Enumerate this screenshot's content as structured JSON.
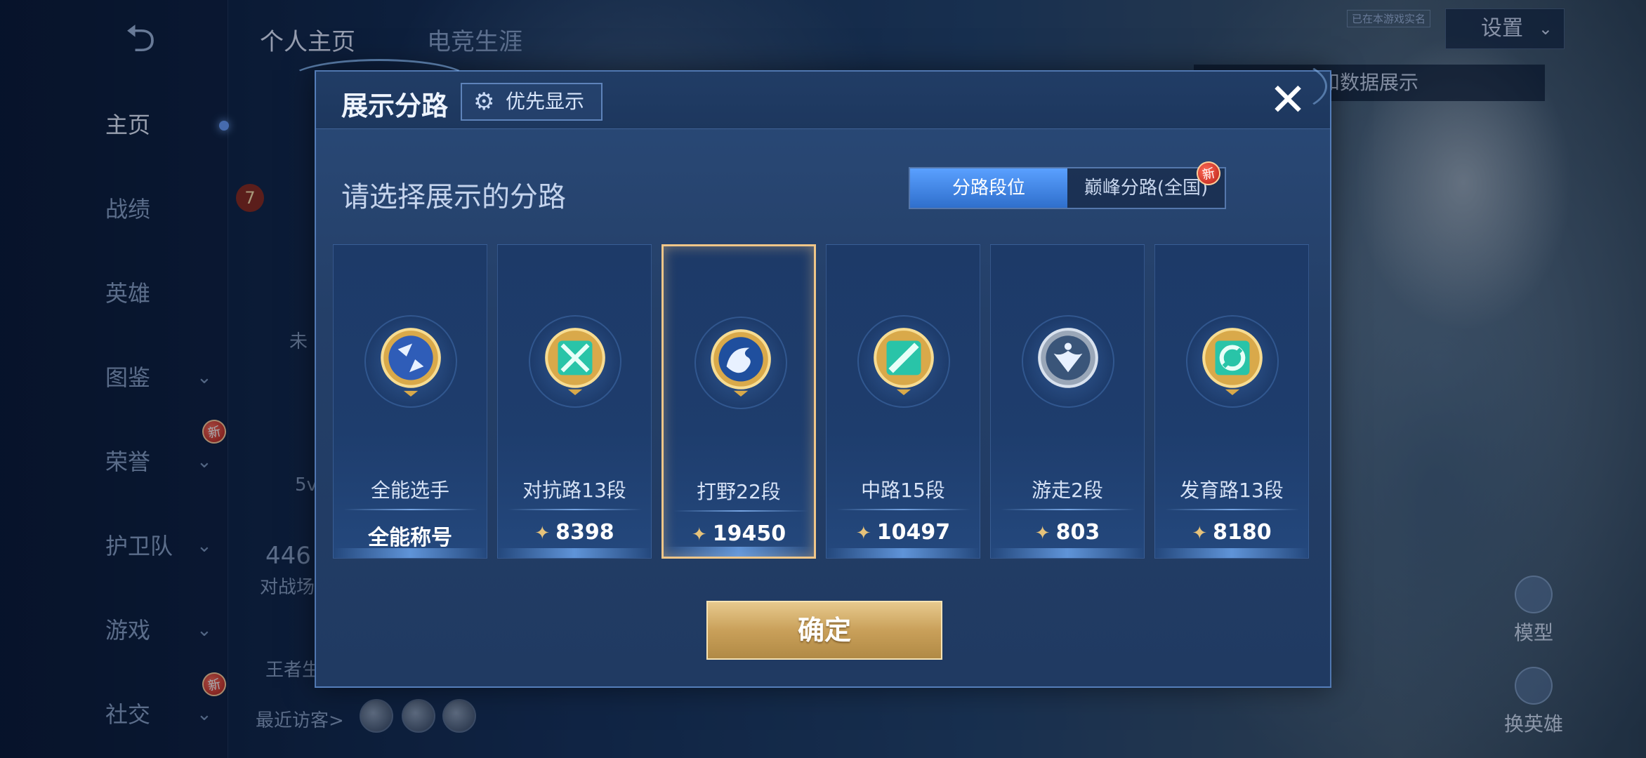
{
  "sidebar": {
    "items": [
      {
        "label": "主页"
      },
      {
        "label": "战绩"
      },
      {
        "label": "英雄"
      },
      {
        "label": "图鉴"
      },
      {
        "label": "荣誉",
        "badge": "新"
      },
      {
        "label": "护卫队"
      },
      {
        "label": "游戏"
      },
      {
        "label": "社交",
        "badge": "新"
      }
    ]
  },
  "top_tabs": [
    "个人主页",
    "电竞生涯"
  ],
  "top_right": {
    "tag": "已在本游戏实名",
    "settings_label": "设置",
    "hint": "点切换灵宝和数据展示"
  },
  "background_text": {
    "level": "7",
    "left_stat_a": "5v",
    "left_stat_num": "446",
    "left_stat_label": "对战场",
    "left_glory": "王者生",
    "recent_visitors": "最近访客>",
    "unlabeled": "未"
  },
  "right_buttons": [
    {
      "label": "模型",
      "icon": "model-icon"
    },
    {
      "label": "换英雄",
      "icon": "swap-hero-icon"
    }
  ],
  "dialog": {
    "title": "展示分路",
    "priority_label": "优先显示",
    "prompt": "请选择展示的分路",
    "tabs": [
      {
        "label": "分路段位",
        "active": true
      },
      {
        "label": "巅峰分路(全国)",
        "active": false,
        "badge": "新"
      }
    ],
    "cards": [
      {
        "name": "全能选手",
        "value": "全能称号",
        "has_points_icon": false,
        "selected": false,
        "emblem": "all-round-emblem-icon"
      },
      {
        "name": "对抗路13段",
        "value": "8398",
        "has_points_icon": true,
        "selected": false,
        "emblem": "clash-lane-emblem-icon"
      },
      {
        "name": "打野22段",
        "value": "19450",
        "has_points_icon": true,
        "selected": true,
        "emblem": "jungle-dragon-emblem-icon"
      },
      {
        "name": "中路15段",
        "value": "10497",
        "has_points_icon": true,
        "selected": false,
        "emblem": "mid-lane-emblem-icon"
      },
      {
        "name": "游走2段",
        "value": "803",
        "has_points_icon": true,
        "selected": false,
        "emblem": "roam-emblem-icon"
      },
      {
        "name": "发育路13段",
        "value": "8180",
        "has_points_icon": true,
        "selected": false,
        "emblem": "farm-lane-emblem-icon"
      }
    ],
    "confirm_label": "确定"
  },
  "colors": {
    "accent_blue": "#3f86e6",
    "gold": "#e6c27a",
    "selected_border": "#f0c688"
  }
}
